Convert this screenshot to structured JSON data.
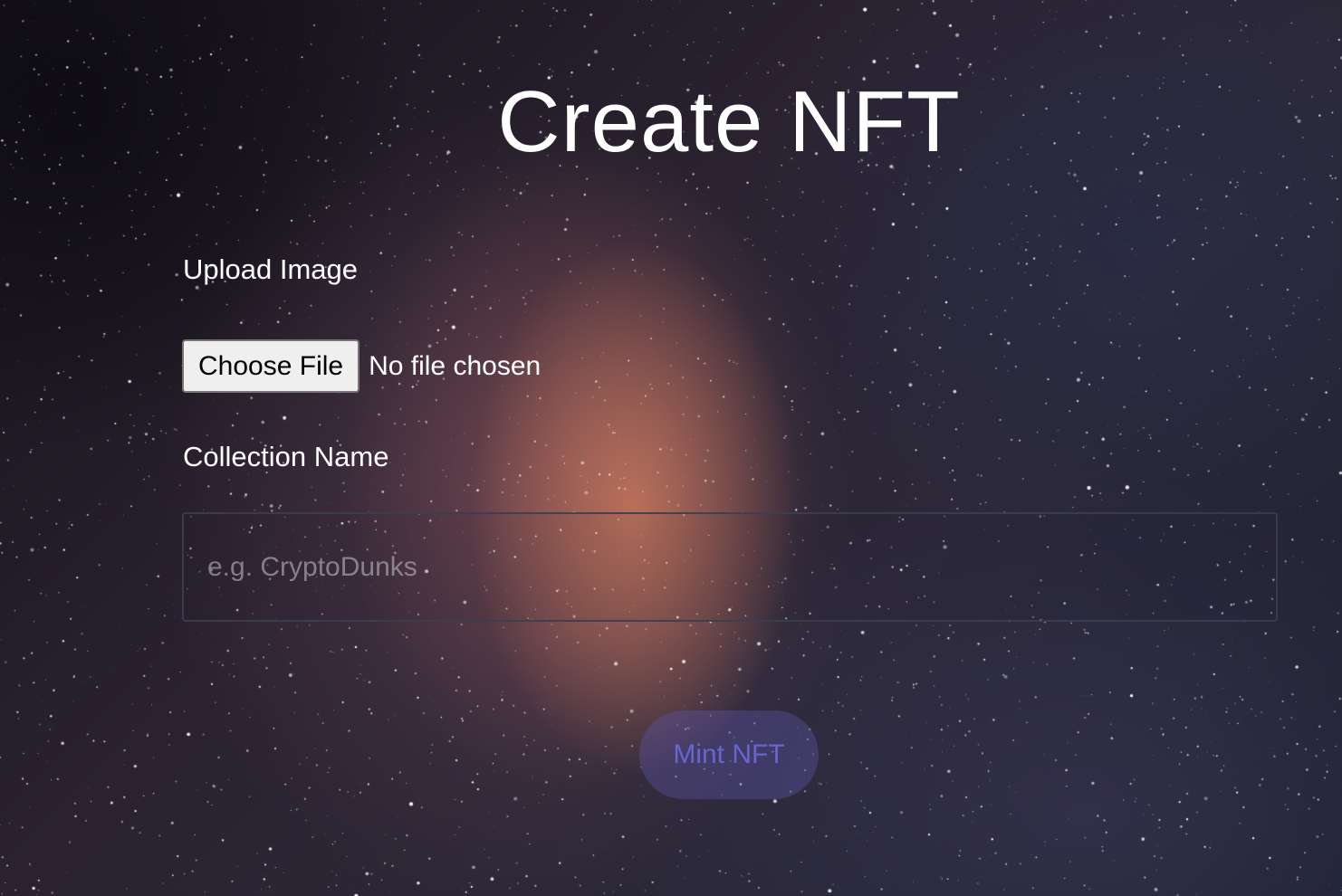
{
  "page": {
    "title": "Create NFT"
  },
  "upload": {
    "label": "Upload Image",
    "button_label": "Choose File",
    "status_text": "No file chosen"
  },
  "collection": {
    "label": "Collection Name",
    "value": "",
    "placeholder": "e.g. CryptoDunks"
  },
  "mint": {
    "button_label": "Mint NFT"
  },
  "colors": {
    "text": "#ffffff",
    "file_button_bg": "#efefef",
    "mint_button_text": "#6e6adc"
  }
}
